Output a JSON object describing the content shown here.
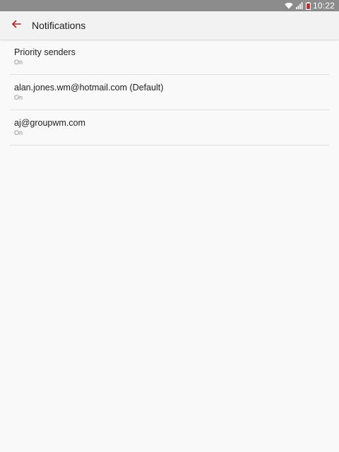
{
  "status_bar": {
    "time": "10:22",
    "icons": [
      "wifi-icon",
      "signal-icon",
      "battery-icon"
    ],
    "background": "#8c8c8c"
  },
  "app_bar": {
    "title": "Notifications",
    "back_icon": "arrow-back-icon",
    "accent": "#b0221f"
  },
  "items": [
    {
      "title": "Priority senders",
      "status": "On"
    },
    {
      "title": "alan.jones.wm@hotmail.com (Default)",
      "status": "On"
    },
    {
      "title": "aj@groupwm.com",
      "status": "On"
    }
  ]
}
